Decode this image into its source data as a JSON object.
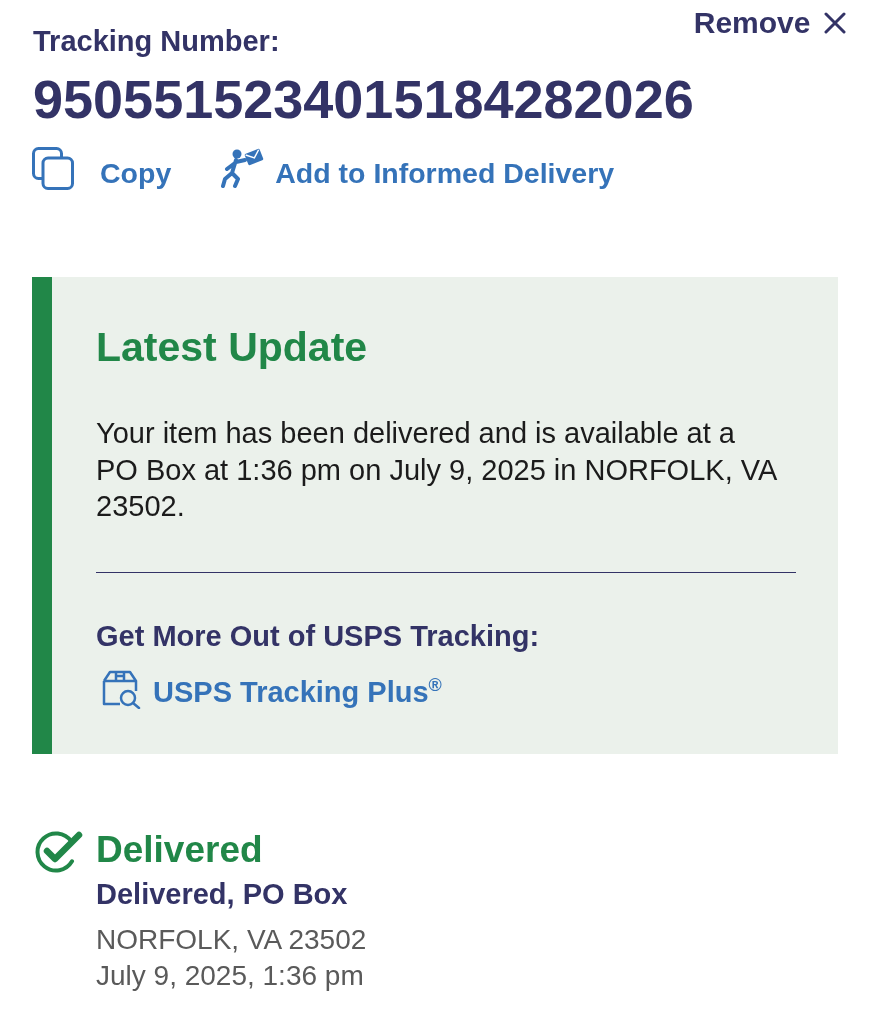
{
  "header": {
    "remove_label": "Remove"
  },
  "tracking": {
    "label": "Tracking Number:",
    "number": "9505515234015184282026"
  },
  "actions": [
    {
      "kind": "copy",
      "label": "Copy"
    },
    {
      "kind": "informed_delivery",
      "label": "Add to Informed Delivery"
    }
  ],
  "latest_update": {
    "title": "Latest Update",
    "message": "Your item has been delivered and is available at a PO Box at 1:36 pm on July 9, 2025 in NORFOLK, VA 23502.",
    "promo_heading": "Get More Out of USPS Tracking:",
    "promo_link": "USPS Tracking Plus$^{®}$"
  },
  "status": {
    "kind": "delivered",
    "title": "Delivered",
    "detail": "Delivered, PO Box",
    "location": "NORFOLK, VA 23502",
    "timestamp": "July 9, 2025, 1:36 pm"
  }
}
